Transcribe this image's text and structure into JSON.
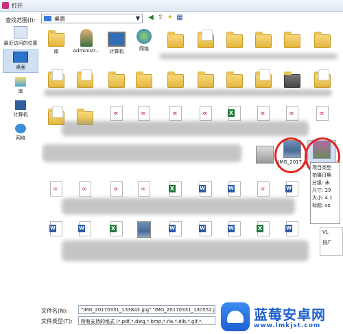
{
  "window": {
    "title": "打开"
  },
  "toolbar": {
    "look_in_label": "查找范围(I):",
    "look_in_value": "桌面"
  },
  "places": [
    {
      "label": "最近访问的位置"
    },
    {
      "label": "桌面"
    },
    {
      "label": "库"
    },
    {
      "label": "计算机"
    },
    {
      "label": "网络"
    }
  ],
  "files": {
    "lib": "库",
    "admin": "Administr...",
    "computer": "计算机",
    "network": "网络",
    "img1": "IMG_2017..."
  },
  "tooltip": {
    "lines": [
      "项目类型",
      "拍摄日期",
      "分级: 未",
      "尺寸: 29",
      "大小: 4.1",
      "标题: co"
    ],
    "menu": [
      "VL",
      "排广"
    ]
  },
  "footer": {
    "filename_label": "文件名(N):",
    "filename_value": "\"IMG_20170331_133843.jpg\" \"IMG_20170331_130552.jpg\"",
    "filetype_label": "文件类型(T):",
    "filetype_value": "所有支持的格式 (*.pdf,*.dwg,*.bmp,*.rle,*.dib,*.gif,*."
  },
  "watermark": {
    "title": "蓝莓安卓网",
    "url": "www.lmkjst.com"
  }
}
